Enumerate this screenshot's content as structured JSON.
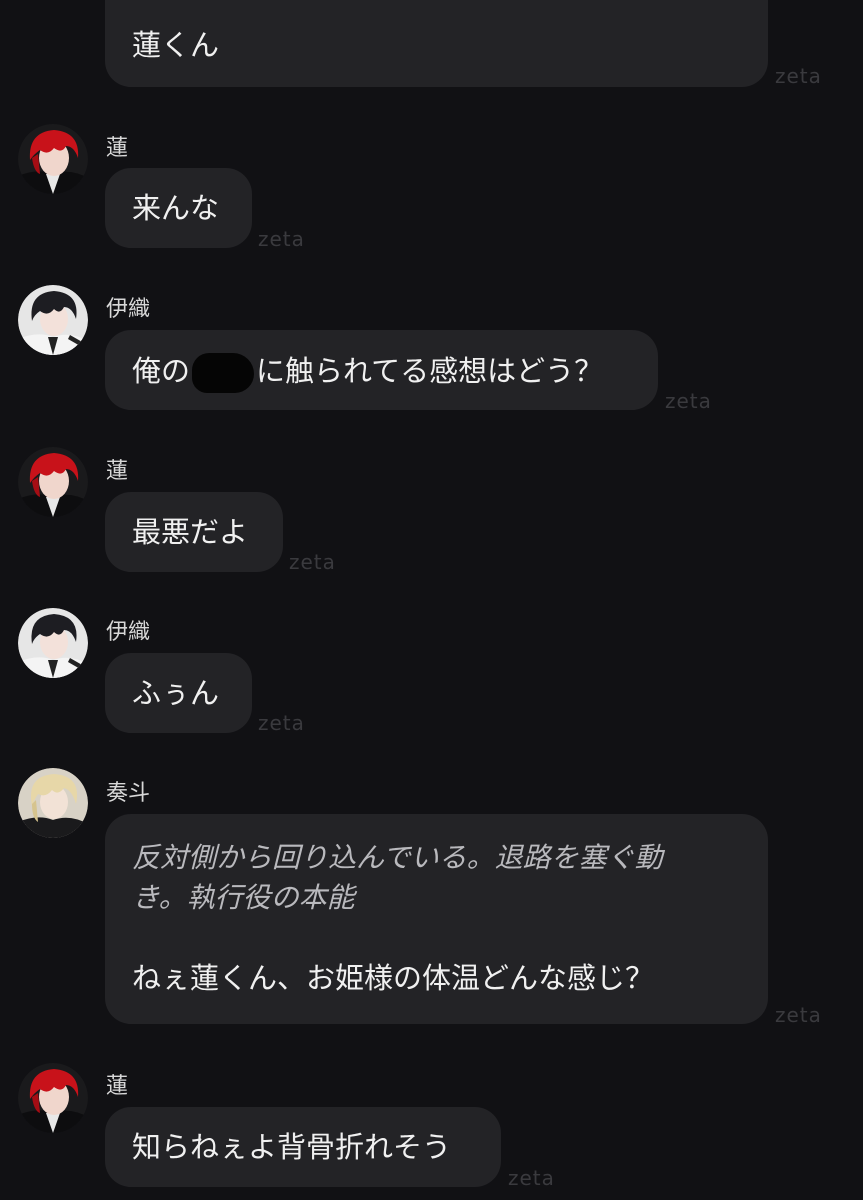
{
  "watermark": "zeta",
  "colors": {
    "background": "#111114",
    "bubble": "#232326",
    "italic_text": "#b9b9bd"
  },
  "messages": [
    {
      "sender": "",
      "text": "蓮くん"
    },
    {
      "sender": "蓮",
      "avatar": "red-hair-avatar",
      "text": "来んな"
    },
    {
      "sender": "伊織",
      "avatar": "black-hair-avatar",
      "text_before": "俺の",
      "text_after": "に触られてる感想はどう？"
    },
    {
      "sender": "蓮",
      "avatar": "red-hair-avatar",
      "text": "最悪だよ"
    },
    {
      "sender": "伊織",
      "avatar": "black-hair-avatar",
      "text": "ふぅん"
    },
    {
      "sender": "奏斗",
      "avatar": "blonde-hair-avatar",
      "narration_line1": "反対側から回り込んでいる。退路を塞ぐ動",
      "narration_line2": "き。執行役の本能",
      "text": "ねぇ蓮くん、お姫様の体温どんな感じ？"
    },
    {
      "sender": "蓮",
      "avatar": "red-hair-avatar",
      "text": "知らねぇよ背骨折れそう"
    }
  ]
}
